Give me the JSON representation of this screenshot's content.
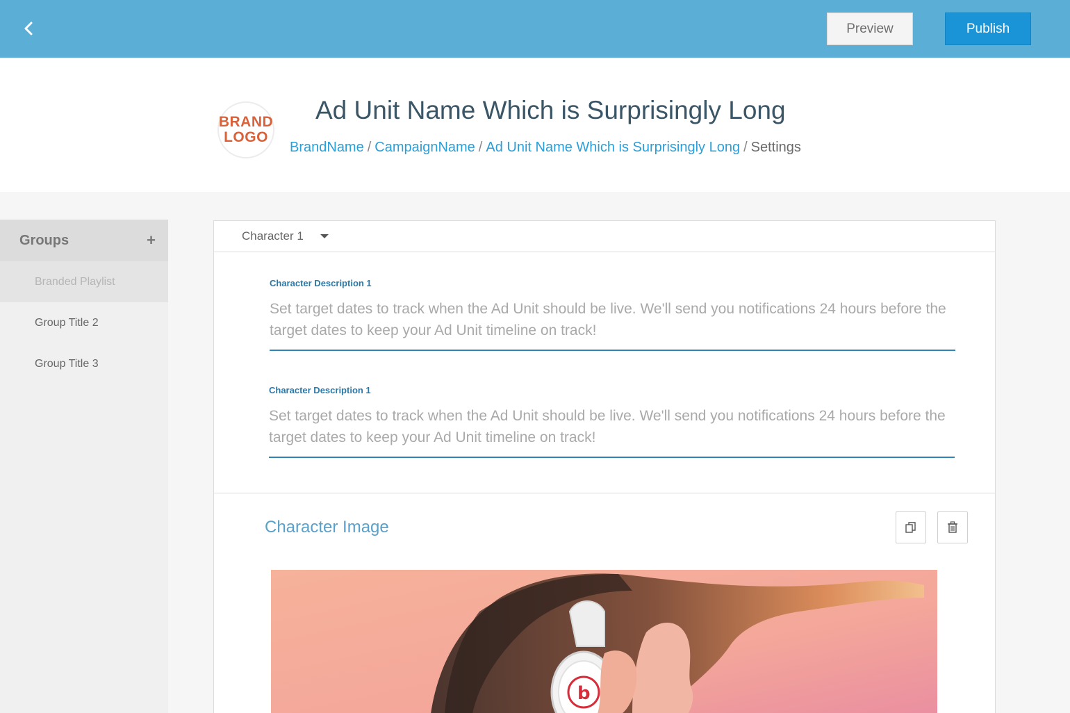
{
  "topbar": {
    "preview_label": "Preview",
    "publish_label": "Publish",
    "accent": "#5bafd6",
    "publish_color": "#1a94d6"
  },
  "header": {
    "logo_line1": "BRAND",
    "logo_line2": "LOGO",
    "title": "Ad Unit Name Which is Surprisingly Long",
    "breadcrumb": {
      "brand": "BrandName",
      "campaign": "CampaignName",
      "ad_unit": "Ad Unit Name Which is Surprisingly Long",
      "current": "Settings",
      "separator": "/"
    }
  },
  "sidebar": {
    "title": "Groups",
    "add_icon": "plus-icon",
    "items": [
      {
        "label": "Branded Playlist",
        "active": true
      },
      {
        "label": "Group Title 2",
        "active": false
      },
      {
        "label": "Group Title 3",
        "active": false
      }
    ]
  },
  "character": {
    "selected": "Character 1",
    "fields": [
      {
        "label": "Character Description 1",
        "placeholder": "Set target dates to track when the Ad Unit should be live. We'll send you notifications 24 hours before the target dates to keep your Ad Unit timeline on track!"
      },
      {
        "label": "Character Description 1",
        "placeholder": "Set target dates to track when the Ad Unit should be live. We'll send you notifications 24 hours before the target dates to keep your Ad Unit timeline on track!"
      }
    ]
  },
  "image_card": {
    "title": "Character Image",
    "actions": [
      "duplicate-icon",
      "trash-icon"
    ]
  }
}
